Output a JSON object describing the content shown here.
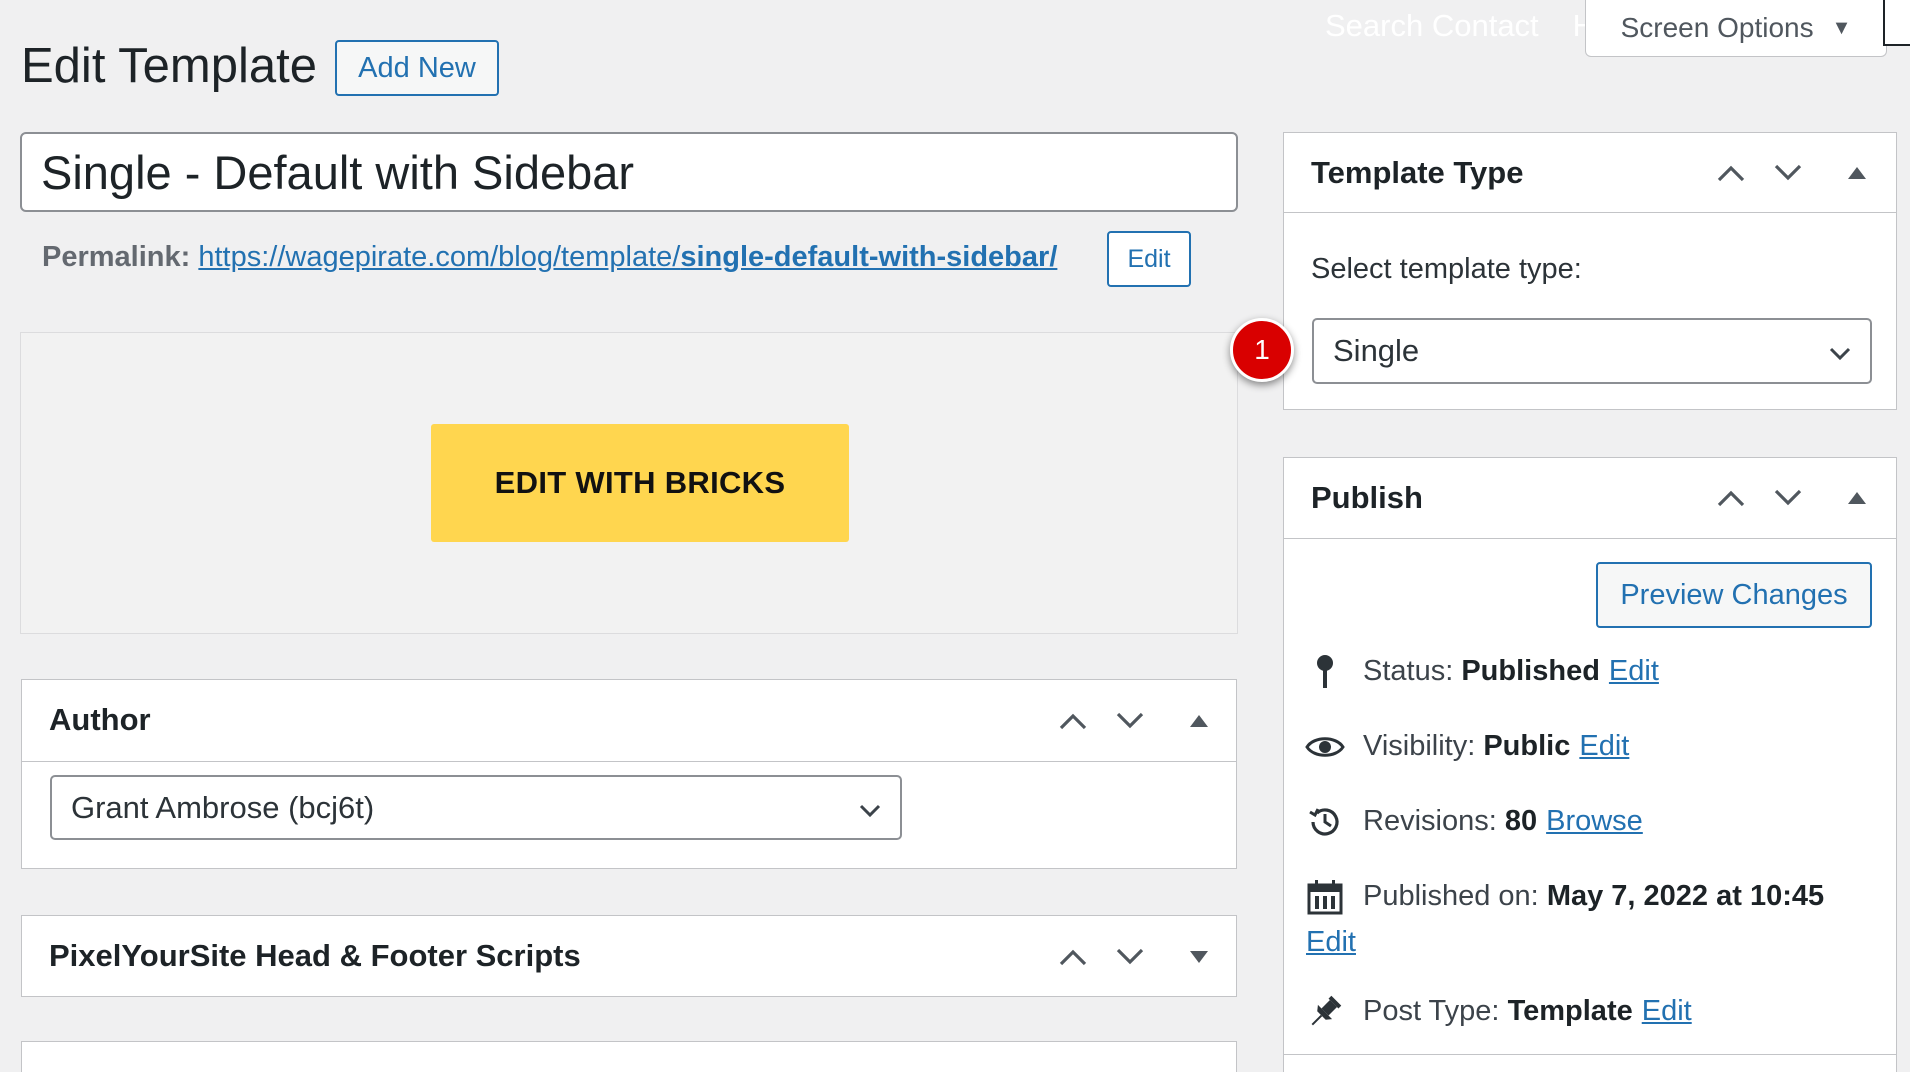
{
  "topbar": {
    "search_contact": "Search Contact",
    "help_initial": "H",
    "screen_options": "Screen Options"
  },
  "header": {
    "title": "Edit Template",
    "add_new": "Add New"
  },
  "post": {
    "title_value": "Single - Default with Sidebar",
    "permalink_label": "Permalink:",
    "permalink_base": "https://wagepirate.com/blog/template/",
    "permalink_slug": "single-default-with-sidebar/",
    "permalink_edit": "Edit"
  },
  "bricks": {
    "button_label": "EDIT WITH BRICKS"
  },
  "author_box": {
    "title": "Author",
    "selected": "Grant Ambrose (bcj6t)"
  },
  "pixel_box": {
    "title": "PixelYourSite Head & Footer Scripts"
  },
  "template_type_box": {
    "title": "Template Type",
    "label": "Select template type:",
    "selected": "Single"
  },
  "annotation": {
    "badge_number": "1",
    "badge_color": "#d90000"
  },
  "publish_box": {
    "title": "Publish",
    "preview_button": "Preview Changes",
    "status": {
      "label": "Status:",
      "value": "Published",
      "link": "Edit"
    },
    "visibility": {
      "label": "Visibility:",
      "value": "Public",
      "link": "Edit"
    },
    "revisions": {
      "label": "Revisions:",
      "value": "80",
      "link": "Browse"
    },
    "published_on": {
      "label": "Published on:",
      "value": "May 7, 2022 at 10:45",
      "link": "Edit"
    },
    "post_type": {
      "label": "Post Type:",
      "value": "Template",
      "link": "Edit"
    }
  },
  "colors": {
    "accent": "#2271b1",
    "bricks_yellow": "#ffd64f",
    "background": "#f0f0f1"
  }
}
